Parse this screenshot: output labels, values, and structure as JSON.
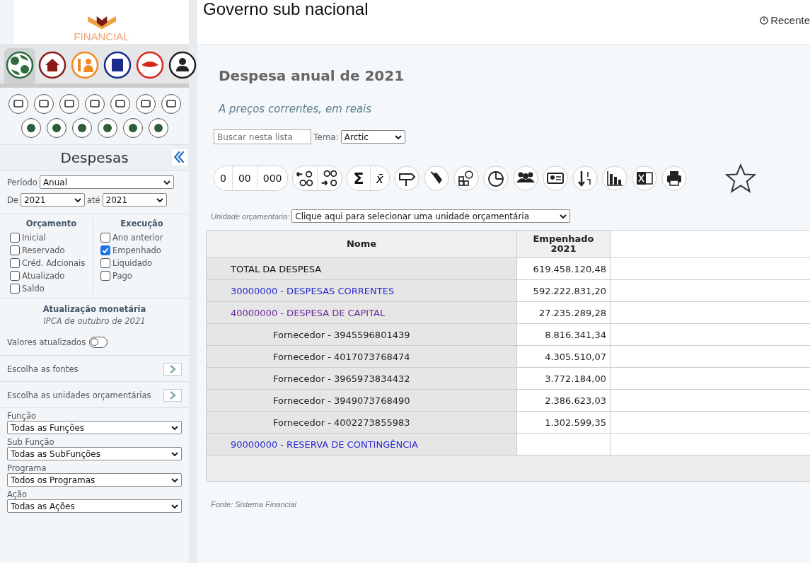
{
  "header": {
    "brand": "FINANCIAL",
    "title": "Governo sub nacional",
    "recent_link": "Recente"
  },
  "sidebar": {
    "modules": [
      {
        "selected": true,
        "color": "#2e6b3e"
      },
      {
        "selected": false,
        "color": "#8b1a1a"
      },
      {
        "selected": false,
        "color": "#f08a24"
      },
      {
        "selected": false,
        "color": "#1a2a8b"
      },
      {
        "selected": false,
        "color": "#d9261c"
      },
      {
        "selected": false,
        "color": "#222222"
      }
    ],
    "section_title": "Despesas",
    "period": {
      "label": "Período",
      "value": "Anual"
    },
    "range": {
      "from_label": "De",
      "from": "2021",
      "to_label": "até",
      "to": "2021"
    },
    "check_groups": [
      {
        "title": "Orçamento",
        "items": [
          {
            "label": "Inicial",
            "checked": false
          },
          {
            "label": "Reservado",
            "checked": false
          },
          {
            "label": "Créd. Adcionais",
            "checked": false
          },
          {
            "label": "Atualizado",
            "checked": false
          },
          {
            "label": "Saldo",
            "checked": false
          }
        ]
      },
      {
        "title": "Execução",
        "items": [
          {
            "label": "Ano anterior",
            "checked": false
          },
          {
            "label": "Empenhado",
            "checked": true
          },
          {
            "label": "Liquidado",
            "checked": false
          },
          {
            "label": "Pago",
            "checked": false
          }
        ]
      }
    ],
    "monetary": {
      "title": "Atualização monetária",
      "subtitle": "IPCA de outubro de 2021",
      "toggle_label": "Valores atualizados",
      "on": false
    },
    "choosers": [
      "Escolha as fontes",
      "Escolha as unidades orçamentárias"
    ],
    "filters": [
      {
        "label": "Função",
        "value": "Todas as Funções"
      },
      {
        "label": "Sub Função",
        "value": "Todas as SubFunções"
      },
      {
        "label": "Programa",
        "value": "Todos os Programas"
      },
      {
        "label": "Ação",
        "value": "Todas as Ações"
      }
    ]
  },
  "main": {
    "title": "Despesa anual de 2021",
    "subtitle": "A preços correntes, em reais",
    "search": {
      "placeholder": "Buscar nesta lista"
    },
    "theme": {
      "label": "Tema:",
      "value": "Arctic"
    },
    "toolbar": {
      "number_formats": [
        "0",
        "00",
        "000"
      ],
      "sum": "Σ",
      "mean": "x̄"
    },
    "unit": {
      "label": "Unidade orçamentaria:",
      "value": "Clique aqui para selecionar uma unidade orçamentária"
    },
    "table": {
      "columns": [
        "Nome",
        "Empenhado 2021"
      ],
      "rows": [
        {
          "kind": "total",
          "name": "TOTAL DA DESPESA",
          "value": "619.458.120,48"
        },
        {
          "kind": "category",
          "visited": false,
          "name": "30000000 - DESPESAS CORRENTES",
          "value": "592.222.831,20"
        },
        {
          "kind": "category",
          "visited": true,
          "name": "40000000 - DESPESA DE CAPITAL",
          "value": "27.235.289,28"
        },
        {
          "kind": "supplier",
          "name": "Fornecedor - 3945596801439",
          "value": "8.816.341,34"
        },
        {
          "kind": "supplier",
          "name": "Fornecedor - 4017073768474",
          "value": "4.305.510,07"
        },
        {
          "kind": "supplier",
          "name": "Fornecedor - 3965973834432",
          "value": "3.772.184,00"
        },
        {
          "kind": "supplier",
          "name": "Fornecedor - 3949073768490",
          "value": "2.386.623,03"
        },
        {
          "kind": "supplier",
          "name": "Fornecedor - 4002273855983",
          "value": "1.302.599,35"
        },
        {
          "kind": "category",
          "visited": false,
          "name": "90000000 - RESERVA DE CONTINGÊNCIA"
        }
      ]
    },
    "source": "Fonte: Sistema Financial"
  }
}
